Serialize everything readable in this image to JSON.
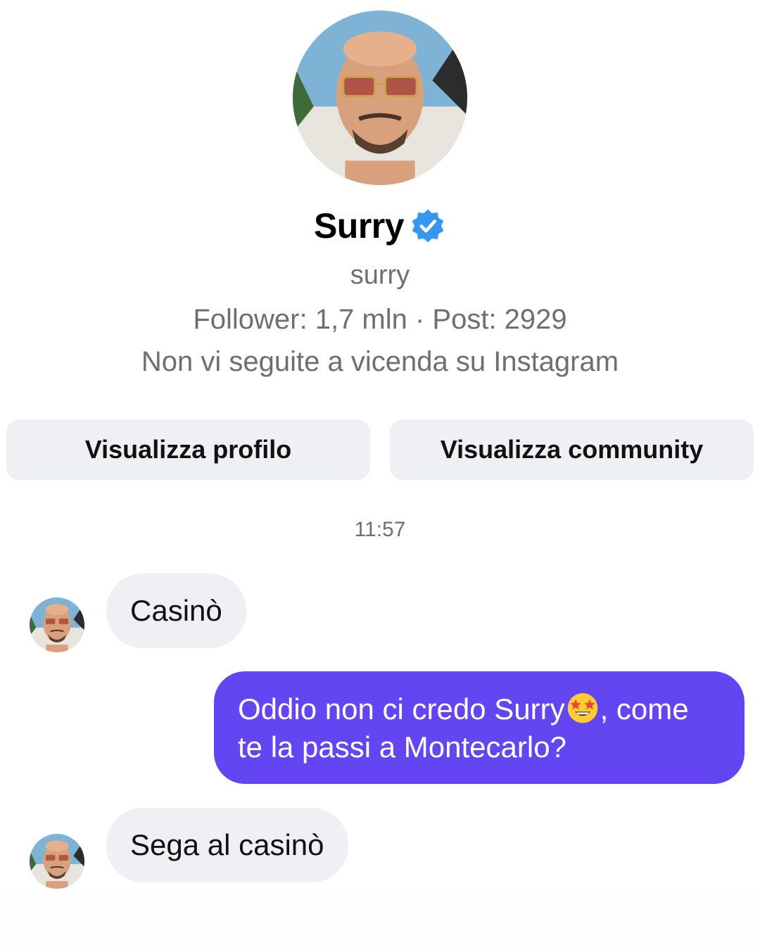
{
  "profile": {
    "display_name": "Surry",
    "verified_icon": "verified-badge-icon",
    "username": "surry",
    "stats": "Follower: 1,7 mln · Post: 2929",
    "mutual_status": "Non vi seguite a vicenda su Instagram",
    "avatar": "profile-photo"
  },
  "actions": {
    "view_profile": "Visualizza profilo",
    "view_community": "Visualizza community"
  },
  "thread": {
    "timestamp": "11:57",
    "messages": [
      {
        "direction": "incoming",
        "text": "Casinò"
      },
      {
        "direction": "outgoing",
        "text_before_emoji": "Oddio non ci credo Surry",
        "emoji": "star-struck-emoji",
        "text_after_emoji": ", come te la passi a Montecarlo?"
      },
      {
        "direction": "incoming",
        "text": "Sega al casinò"
      }
    ]
  },
  "colors": {
    "accent_bubble": "#6346f2",
    "incoming_bubble": "#eff0f3",
    "button_bg": "#eff0f3",
    "verified_blue": "#3797f0",
    "secondary_text": "#6e6e73"
  }
}
